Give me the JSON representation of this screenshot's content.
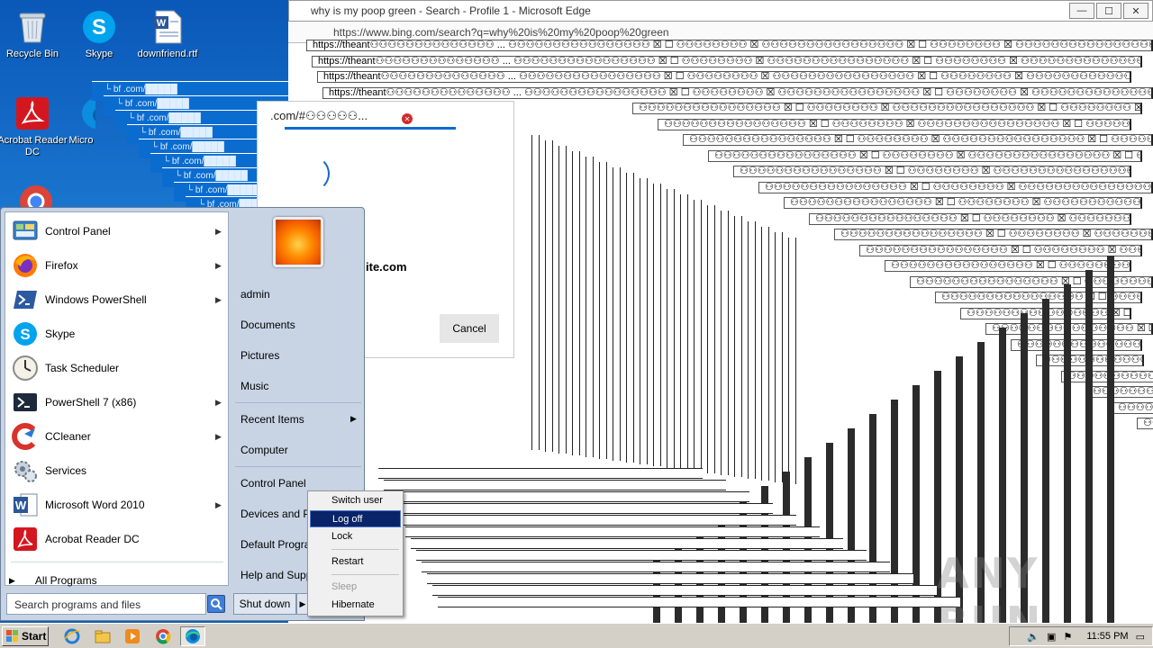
{
  "desktop": {
    "icons": [
      {
        "label": "Recycle Bin",
        "icon": "recycle-bin-icon"
      },
      {
        "label": "Skype",
        "icon": "skype-icon"
      },
      {
        "label": "downfriend.rtf",
        "icon": "word-document-icon"
      },
      {
        "label": "Acrobat Reader DC",
        "icon": "acrobat-icon"
      },
      {
        "label": "Micro",
        "icon": "edge-icon"
      }
    ]
  },
  "edge": {
    "title": "why is my poop green - Search - Profile 1 - Microsoft Edge",
    "url": "https://www.bing.com/search?q=why%20is%20my%20poop%20green",
    "tab_fragment": "https://theant⚇⚇⚇⚇⚇⚇⚇⚇⚇⚇⚇⚇⚇⚇ ...",
    "rows_text": "⚇⚇⚇⚇⚇⚇⚇⚇⚇⚇⚇⚇⚇⚇⚇⚇ ☒ ☐ ⚇⚇⚇⚇⚇⚇⚇⚇ ☒",
    "blue_win_fragment": "└ bf .com/█████"
  },
  "dialog": {
    "title": ".com/#⚇⚇⚇⚇⚇...",
    "site": "ite.com",
    "cancel": "Cancel"
  },
  "start_menu": {
    "programs": [
      {
        "label": "Control Panel",
        "icon": "control-panel-icon",
        "arrow": "▶"
      },
      {
        "label": "Firefox",
        "icon": "firefox-icon",
        "arrow": "▶"
      },
      {
        "label": "Windows PowerShell",
        "icon": "powershell-icon",
        "arrow": "▶"
      },
      {
        "label": "Skype",
        "icon": "skype-icon",
        "arrow": ""
      },
      {
        "label": "Task Scheduler",
        "icon": "task-scheduler-icon",
        "arrow": ""
      },
      {
        "label": "PowerShell 7 (x86)",
        "icon": "powershell7-icon",
        "arrow": "▶"
      },
      {
        "label": "CCleaner",
        "icon": "ccleaner-icon",
        "arrow": "▶"
      },
      {
        "label": "Services",
        "icon": "services-icon",
        "arrow": ""
      },
      {
        "label": "Microsoft Word 2010",
        "icon": "word-icon",
        "arrow": "▶"
      },
      {
        "label": "Acrobat Reader DC",
        "icon": "acrobat-icon",
        "arrow": ""
      }
    ],
    "all_programs": "All Programs",
    "search_placeholder": "Search programs and files",
    "right_items": [
      {
        "label": "admin",
        "arrow": ""
      },
      {
        "label": "Documents",
        "arrow": ""
      },
      {
        "label": "Pictures",
        "arrow": ""
      },
      {
        "label": "Music",
        "arrow": ""
      },
      {
        "label": "Recent Items",
        "arrow": "▶"
      },
      {
        "label": "Computer",
        "arrow": ""
      },
      {
        "label": "Control Panel",
        "arrow": ""
      },
      {
        "label": "Devices and Pri",
        "arrow": ""
      },
      {
        "label": "Default Progra",
        "arrow": ""
      },
      {
        "label": "Help and Suppo",
        "arrow": ""
      }
    ],
    "shutdown": "Shut down",
    "shutdown_arrow": "▶"
  },
  "shutdown_menu": {
    "items": [
      {
        "label": "Switch user",
        "state": "normal"
      },
      {
        "label": "Log off",
        "state": "active"
      },
      {
        "label": "Lock",
        "state": "normal"
      },
      {
        "label": "Restart",
        "state": "normal"
      },
      {
        "label": "Sleep",
        "state": "disabled"
      },
      {
        "label": "Hibernate",
        "state": "normal"
      }
    ]
  },
  "taskbar": {
    "start_label": "Start",
    "pinned": [
      "ie-icon",
      "explorer-icon",
      "media-player-icon",
      "chrome-icon",
      "edge-icon"
    ],
    "clock": "11:55 PM"
  },
  "watermark": "ANY RUN",
  "colors": {
    "selection": "#0a246a",
    "desktop": "#1a6fc4",
    "start_menu_bg": "#c8d4e4"
  }
}
